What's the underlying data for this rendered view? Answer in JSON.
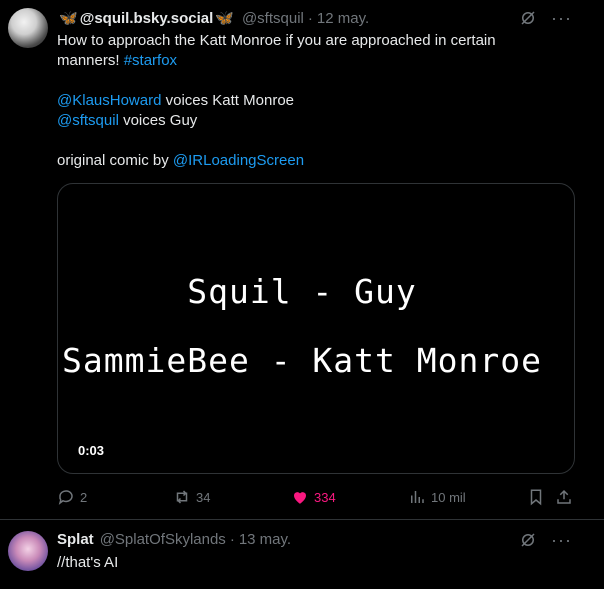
{
  "post": {
    "display_name": "@squil.bsky.social",
    "handle": "@sftsquil",
    "separator": "·",
    "date": "12 may.",
    "text_line1": "How to approach the Katt Monroe if you are approached in certain",
    "text_line2_plain": "manners! ",
    "hashtag": "#starfox",
    "mention1": "@KlausHoward",
    "mention1_rest": " voices Katt Monroe",
    "mention2": "@sftsquil",
    "mention2_rest": " voices Guy",
    "credit_plain": "original comic by ",
    "credit_mention": "@IRLoadingScreen",
    "video": {
      "line1": "Squil - Guy",
      "line2": "SammieBee - Katt Monroe",
      "duration": "0:03"
    },
    "actions": {
      "replies": "2",
      "reposts": "34",
      "likes": "334",
      "views": "10 mil"
    },
    "colors": {
      "accent": "#1d9bf0",
      "like": "#f91880",
      "muted": "#71767b"
    }
  },
  "reply": {
    "display_name": "Splat",
    "handle": "@SplatOfSkylands",
    "separator": "·",
    "date": "13 may.",
    "text": "//that's AI"
  },
  "icons": [
    "grok-icon",
    "more-icon",
    "reply-icon",
    "repost-icon",
    "like-icon",
    "views-icon",
    "bookmark-icon",
    "share-icon",
    "butterfly-icon"
  ]
}
